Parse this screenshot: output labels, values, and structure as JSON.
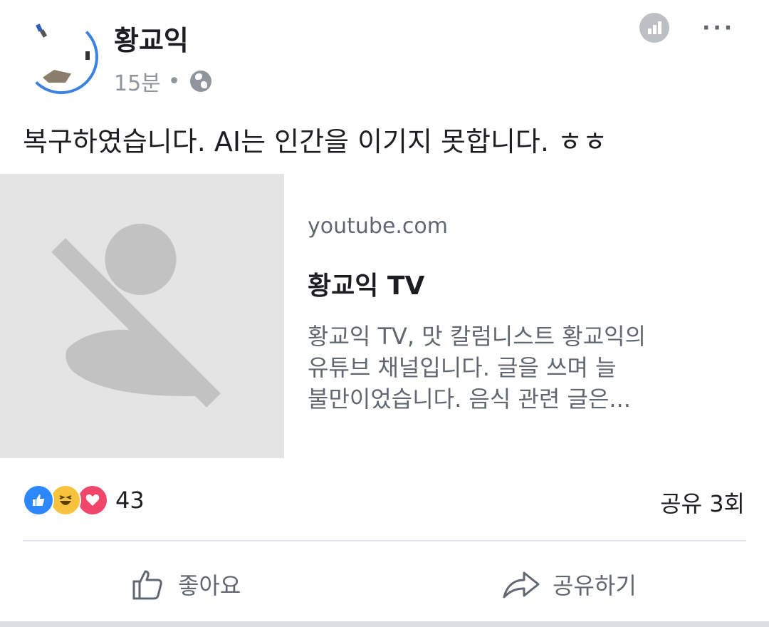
{
  "post": {
    "author": "황교익",
    "time": "15분",
    "separator": "•",
    "privacy_icon": "globe-icon",
    "text": "복구하였습니다. AI는 인간을 이기지 못합니다. ㅎㅎ"
  },
  "header_icons": {
    "insights": "bar-chart-icon",
    "more": "···"
  },
  "link": {
    "thumbnail_icon": "no-image-icon",
    "domain": "youtube.com",
    "title": "황교익 TV",
    "desc_line1": "황교익 TV, 맛 칼럼니스트 황교익의",
    "desc_line2": "유튜브 채널입니다. 글을 쓰며 늘",
    "desc_line3": "불만이었습니다. 음식 관련 글은..."
  },
  "reactions": {
    "icons": [
      "like-icon",
      "haha-icon",
      "love-icon"
    ],
    "count": "43",
    "shares": "공유 3회"
  },
  "actions": {
    "like_label": "좋아요",
    "share_label": "공유하기"
  },
  "colors": {
    "like": "#2d88ff",
    "haha": "#f7c23d",
    "love": "#f0466a",
    "avatar_ring": "#3b82e0"
  }
}
